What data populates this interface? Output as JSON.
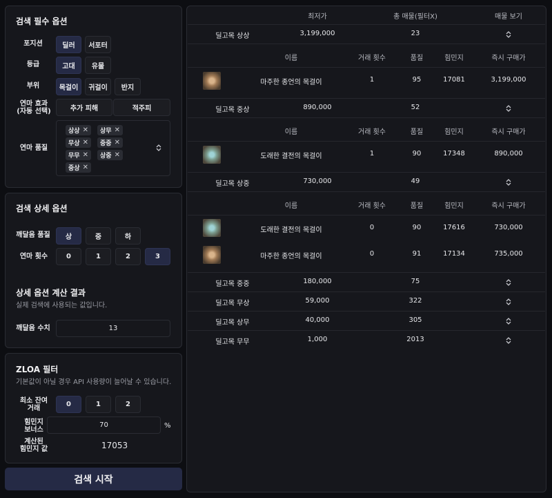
{
  "required": {
    "title": "검색 필수 옵션",
    "position_label": "포지션",
    "positions": [
      "딜러",
      "서포터"
    ],
    "grade_label": "등급",
    "grades": [
      "고대",
      "유물"
    ],
    "part_label": "부위",
    "parts": [
      "목걸이",
      "귀걸이",
      "반지"
    ],
    "effect_label": "연마 효과\n(자동 선택)",
    "effects": [
      "추가 피해",
      "적주피"
    ],
    "quality_label": "연마 품질",
    "qualities": [
      "상상",
      "상무",
      "무상",
      "중중",
      "무무",
      "상중",
      "중상"
    ]
  },
  "detail": {
    "title": "검색 상세 옵션",
    "enlight_quality_label": "깨달음 품질",
    "enlight_qualities": [
      "상",
      "중",
      "하"
    ],
    "polish_count_label": "연마 횟수",
    "polish_counts": [
      "0",
      "1",
      "2",
      "3"
    ],
    "result_title": "상세 옵션 계산 결과",
    "result_sub": "실제 검색에 사용되는 값입니다.",
    "enlight_value_label": "깨달음 수치",
    "enlight_value": "13"
  },
  "zloa": {
    "title": "ZLOA 필터",
    "sub": "기본값이 아닐 경우 API 사용량이 늘어날 수 있습니다.",
    "min_trade_label": "최소 잔여\n거래",
    "min_trades": [
      "0",
      "1",
      "2"
    ],
    "agility_bonus_label": "힘민지\n보너스",
    "agility_bonus": "70",
    "percent": "%",
    "calc_label": "계산된\n힘민지 값",
    "calc_value": "17053"
  },
  "search_button": "검색 시작",
  "table": {
    "headers": [
      "최저가",
      "총 매물(필터X)",
      "매물 보기"
    ],
    "sub_headers": [
      "이름",
      "거래 횟수",
      "품질",
      "힘민지",
      "즉시 구매가"
    ],
    "groups": [
      {
        "name": "딜고목 상상",
        "price": "3,199,000",
        "count": "23",
        "expanded": true,
        "items": [
          {
            "name": "마주한 종언의 목걸이",
            "trades": "1",
            "quality": "95",
            "stat": "17081",
            "buy": "3,199,000"
          }
        ]
      },
      {
        "name": "딜고목 중상",
        "price": "890,000",
        "count": "52",
        "expanded": true,
        "items": [
          {
            "name": "도래한 결전의 목걸이",
            "trades": "1",
            "quality": "90",
            "stat": "17348",
            "buy": "890,000"
          }
        ]
      },
      {
        "name": "딜고목 상중",
        "price": "730,000",
        "count": "49",
        "expanded": true,
        "items": [
          {
            "name": "도래한 결전의 목걸이",
            "trades": "0",
            "quality": "90",
            "stat": "17616",
            "buy": "730,000"
          },
          {
            "name": "마주한 종언의 목걸이",
            "trades": "0",
            "quality": "91",
            "stat": "17134",
            "buy": "735,000"
          }
        ]
      },
      {
        "name": "딜고목 중중",
        "price": "180,000",
        "count": "75",
        "expanded": false,
        "items": []
      },
      {
        "name": "딜고목 무상",
        "price": "59,000",
        "count": "322",
        "expanded": false,
        "items": []
      },
      {
        "name": "딜고목 상무",
        "price": "40,000",
        "count": "305",
        "expanded": false,
        "items": []
      },
      {
        "name": "딜고목 무무",
        "price": "1,000",
        "count": "2013",
        "expanded": false,
        "items": []
      }
    ]
  }
}
